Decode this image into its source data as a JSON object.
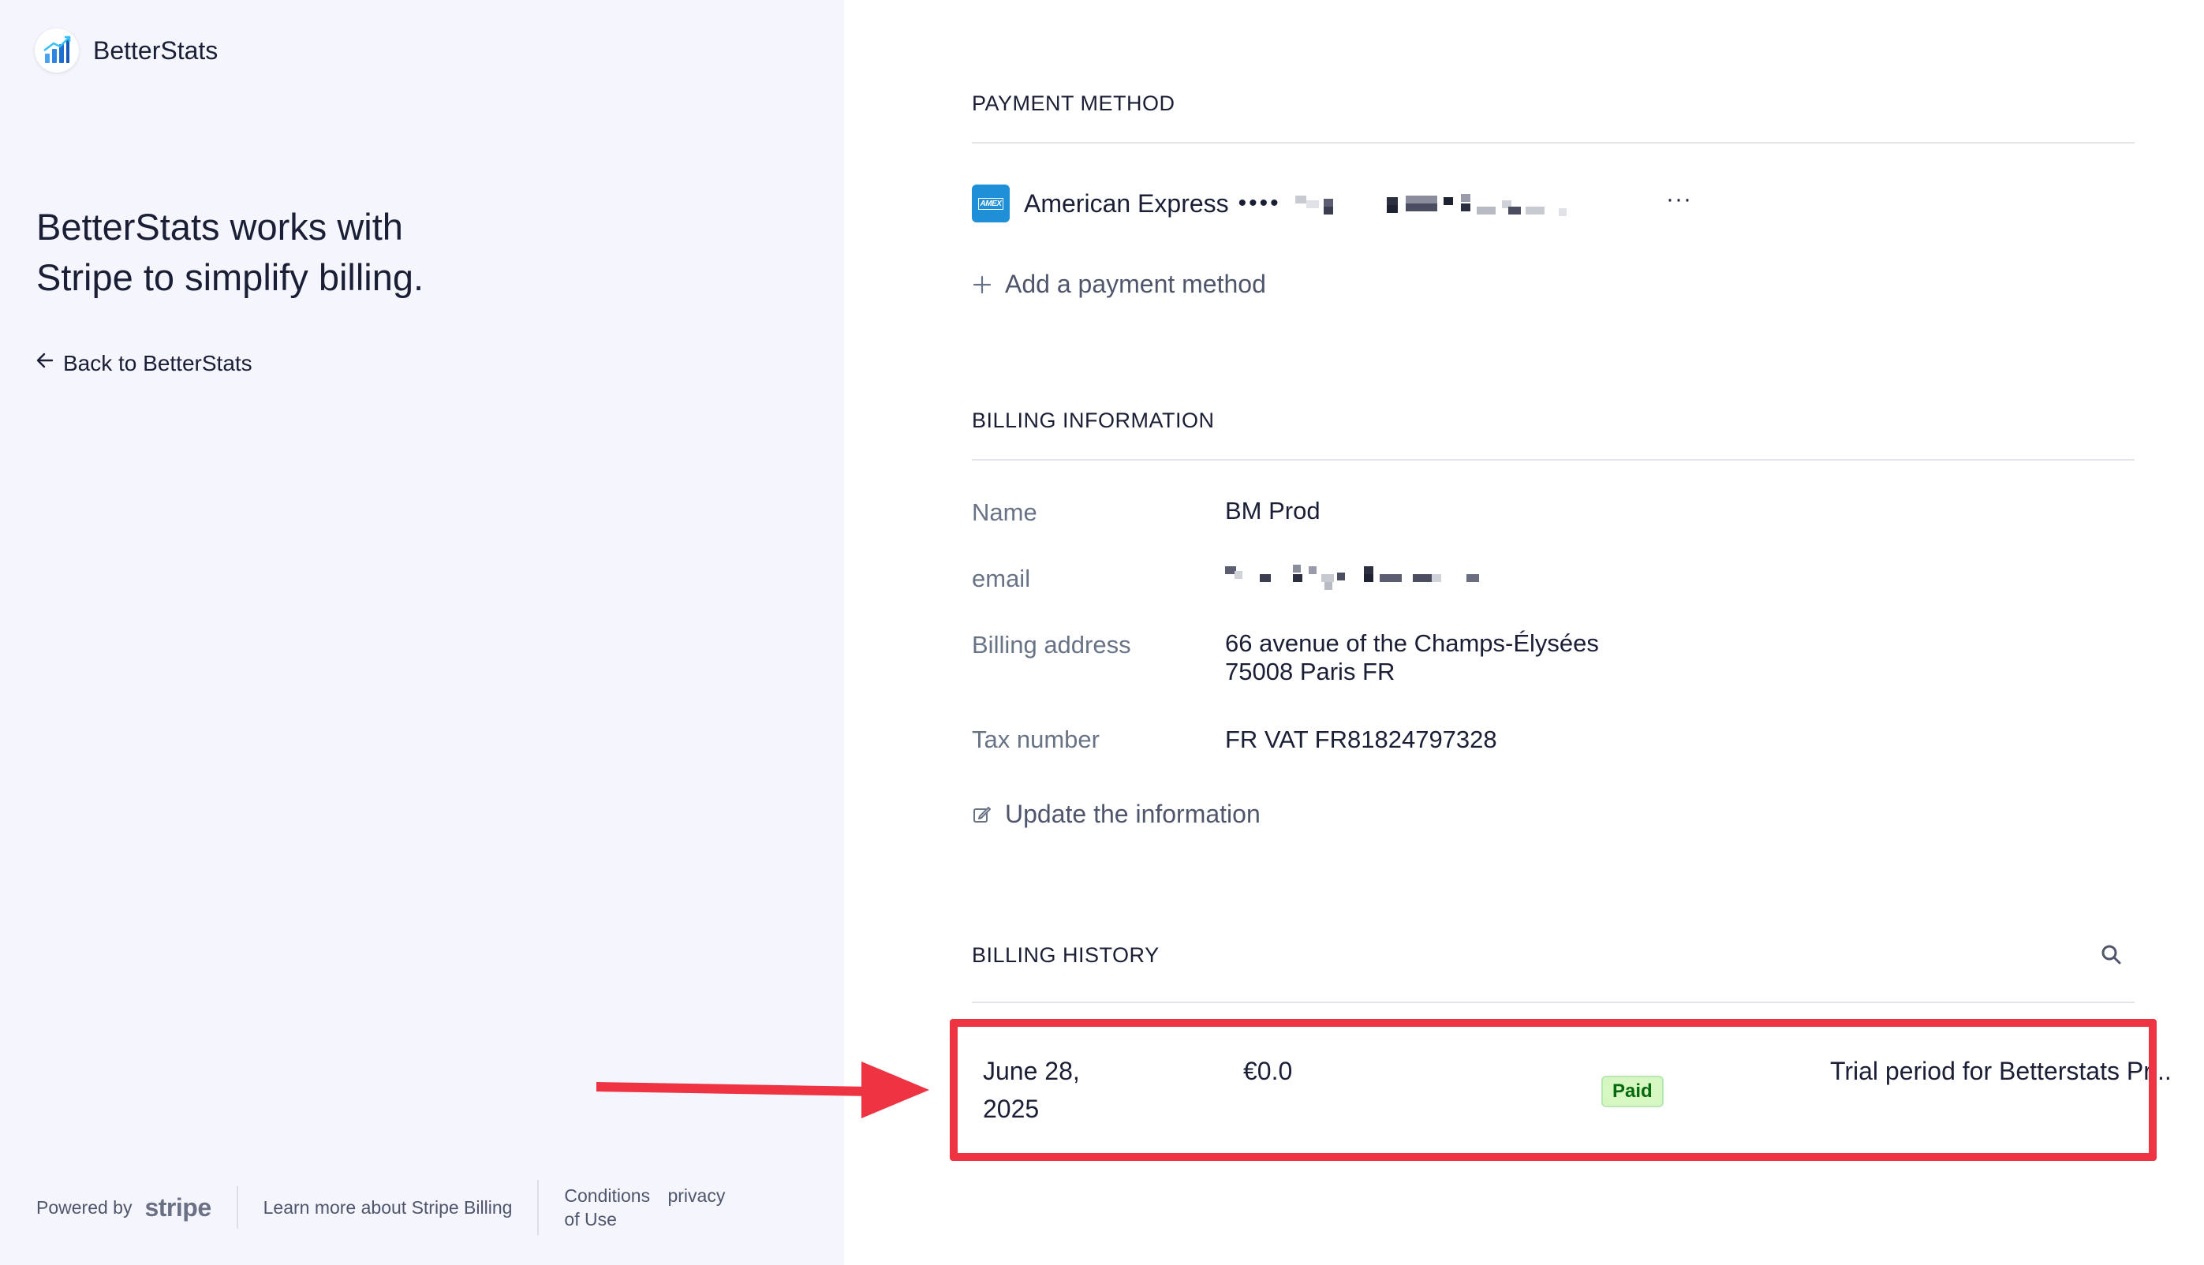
{
  "brand": {
    "name": "BetterStats",
    "logo_icon": "bar-chart-icon"
  },
  "left_panel": {
    "headline_line1": "BetterStats works with",
    "headline_line2": "Stripe to simplify billing.",
    "back_link": "Back to BetterStats"
  },
  "footer": {
    "powered_by": "Powered by",
    "stripe_logo": "stripe",
    "learn_more": "Learn more about Stripe Billing",
    "conditions": "Conditions",
    "of_use": "of Use",
    "privacy": "privacy"
  },
  "payment_method": {
    "title": "PAYMENT METHOD",
    "card_brand": "American Express",
    "masked_digits": "••••",
    "more_label": "···",
    "add_label": "Add a payment method"
  },
  "billing_info": {
    "title": "BILLING INFORMATION",
    "name_label": "Name",
    "name_value": "BM Prod",
    "email_label": "email",
    "address_label": "Billing address",
    "address_line1": "66 avenue of the Champs-Élysées",
    "address_line2": "75008 Paris FR",
    "tax_label": "Tax number",
    "tax_value": "FR VAT FR81824797328",
    "update_label": "Update the information"
  },
  "billing_history": {
    "title": "BILLING HISTORY",
    "rows": [
      {
        "date_line1": "June 28,",
        "date_line2": "2025",
        "amount": "€0.0",
        "status": "Paid",
        "description": "Trial period for Betterstats Pr..."
      }
    ]
  },
  "colors": {
    "accent_blue": "#1f8fd8",
    "left_bg": "#f4f5fd",
    "annotation_red": "#ee3342",
    "paid_green": "#05690d"
  }
}
